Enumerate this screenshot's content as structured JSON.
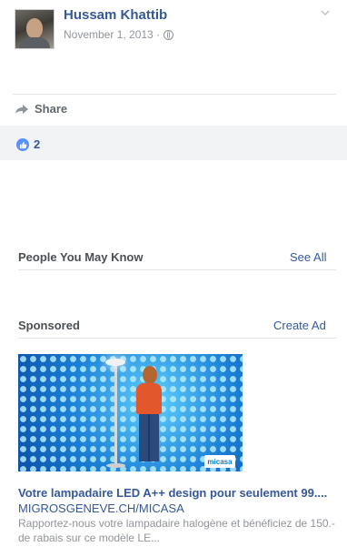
{
  "post": {
    "author": "Hussam Khattib",
    "date": "November 1, 2013 · ",
    "privacy_icon": "globe-icon",
    "options_icon": "chevron-down-icon"
  },
  "actions": {
    "share_label": "Share",
    "share_icon": "share-arrow-icon"
  },
  "reactions": {
    "like_icon": "thumbs-up-icon",
    "count": "2"
  },
  "people_you_may_know": {
    "title": "People You May Know",
    "link": "See All"
  },
  "sponsored": {
    "title": "Sponsored",
    "link": "Create Ad"
  },
  "ad": {
    "image_logo_text": "micasa",
    "headline": "Votre lampadaire LED A++ design pour seulement 99....",
    "domain": "MIGROSGENEVE.CH/MICASA",
    "description": "Rapportez-nous votre lampadaire halogène et bénéficiez de 150.- de rabais sur ce modèle LE..."
  },
  "colors": {
    "link_blue": "#365899",
    "like_blue": "#5890ff",
    "muted_gray": "#90949c",
    "reaction_bg": "#f2f3f5"
  }
}
